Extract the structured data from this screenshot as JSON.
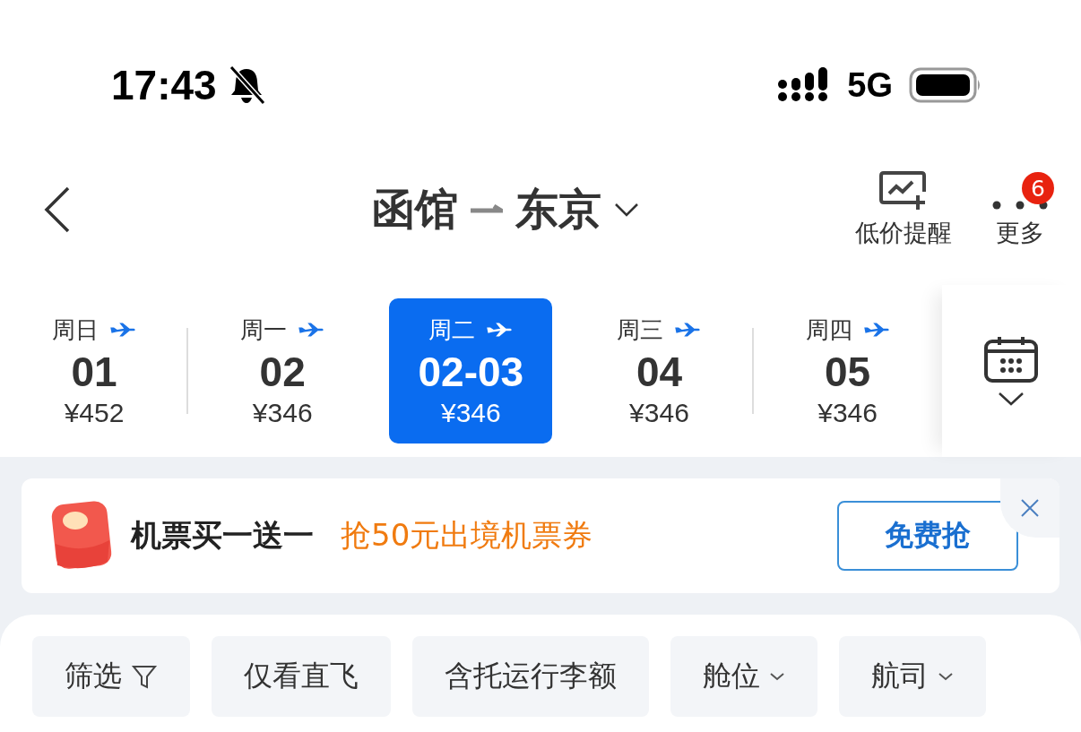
{
  "status_bar": {
    "time": "17:43",
    "network": "5G"
  },
  "header": {
    "from": "函馆",
    "to": "东京",
    "actions": [
      {
        "kind": "price-alert",
        "label": "低价提醒"
      },
      {
        "kind": "more",
        "label": "更多",
        "badge": "6"
      }
    ]
  },
  "dates": [
    {
      "weekday": "周日",
      "date": "01",
      "price": "¥452",
      "selected": false
    },
    {
      "weekday": "周一",
      "date": "02",
      "price": "¥346",
      "selected": false
    },
    {
      "weekday": "周二",
      "date": "02-03",
      "price": "¥346",
      "selected": true
    },
    {
      "weekday": "周三",
      "date": "04",
      "price": "¥346",
      "selected": false
    },
    {
      "weekday": "周四",
      "date": "05",
      "price": "¥346",
      "selected": false
    }
  ],
  "banner": {
    "title": "机票买一送一",
    "offer": "抢50元出境机票券",
    "button": "免费抢"
  },
  "filters": [
    {
      "label": "筛选",
      "kind": "filter"
    },
    {
      "label": "仅看直飞",
      "kind": "plain"
    },
    {
      "label": "含托运行李额",
      "kind": "plain"
    },
    {
      "label": "舱位",
      "kind": "dropdown"
    },
    {
      "label": "航司",
      "kind": "dropdown"
    }
  ]
}
